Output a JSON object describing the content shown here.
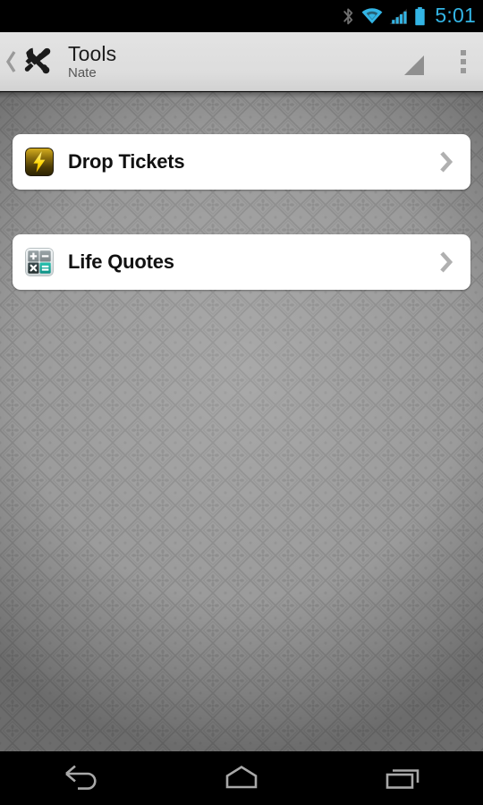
{
  "status_bar": {
    "time": "5:01",
    "accent_color": "#33b5e5",
    "background": "#000000",
    "icons": [
      {
        "name": "bluetooth-icon",
        "label": "Bluetooth"
      },
      {
        "name": "wifi-icon",
        "label": "Wi-Fi"
      },
      {
        "name": "cellular-signal-icon",
        "label": "Cellular signal"
      },
      {
        "name": "battery-icon",
        "label": "Battery"
      }
    ]
  },
  "action_bar": {
    "up_affordance": "‹",
    "app_icon_name": "tools-icon",
    "title": "Tools",
    "subtitle": "Nate",
    "spinner_caret_name": "spinner-caret-icon",
    "overflow_menu_label": "More options",
    "background": "#dddddd",
    "title_color": "#1c1c1c",
    "subtitle_color": "#555555"
  },
  "wallpaper": {
    "base_color": "#9a9a9a",
    "pattern_name": "diamond-damask-pattern",
    "vignette": true
  },
  "list": {
    "items": [
      {
        "label": "Drop Tickets",
        "icon_name": "lightning-bolt-icon",
        "icon_colors": {
          "background_top": "#c9a21a",
          "background_bottom": "#3a2f05",
          "glyph": "#ffe033"
        },
        "chevron_name": "chevron-right-icon",
        "chevron_color": "#b0b0b0"
      },
      {
        "label": "Life Quotes",
        "icon_name": "calculator-icon",
        "icon_colors": {
          "background": "#e6e9ea",
          "key_gray": "#8a9396",
          "key_dark": "#2f3b3e",
          "key_teal": "#16a79a"
        },
        "chevron_name": "chevron-right-icon",
        "chevron_color": "#b0b0b0"
      }
    ],
    "card_background": "#ffffff",
    "label_color": "#111111"
  },
  "nav_bar": {
    "background": "#000000",
    "icon_color": "#a8a8a8",
    "buttons": [
      {
        "name": "nav-back-button",
        "label": "Back"
      },
      {
        "name": "nav-home-button",
        "label": "Home"
      },
      {
        "name": "nav-recents-button",
        "label": "Recent apps"
      }
    ]
  }
}
